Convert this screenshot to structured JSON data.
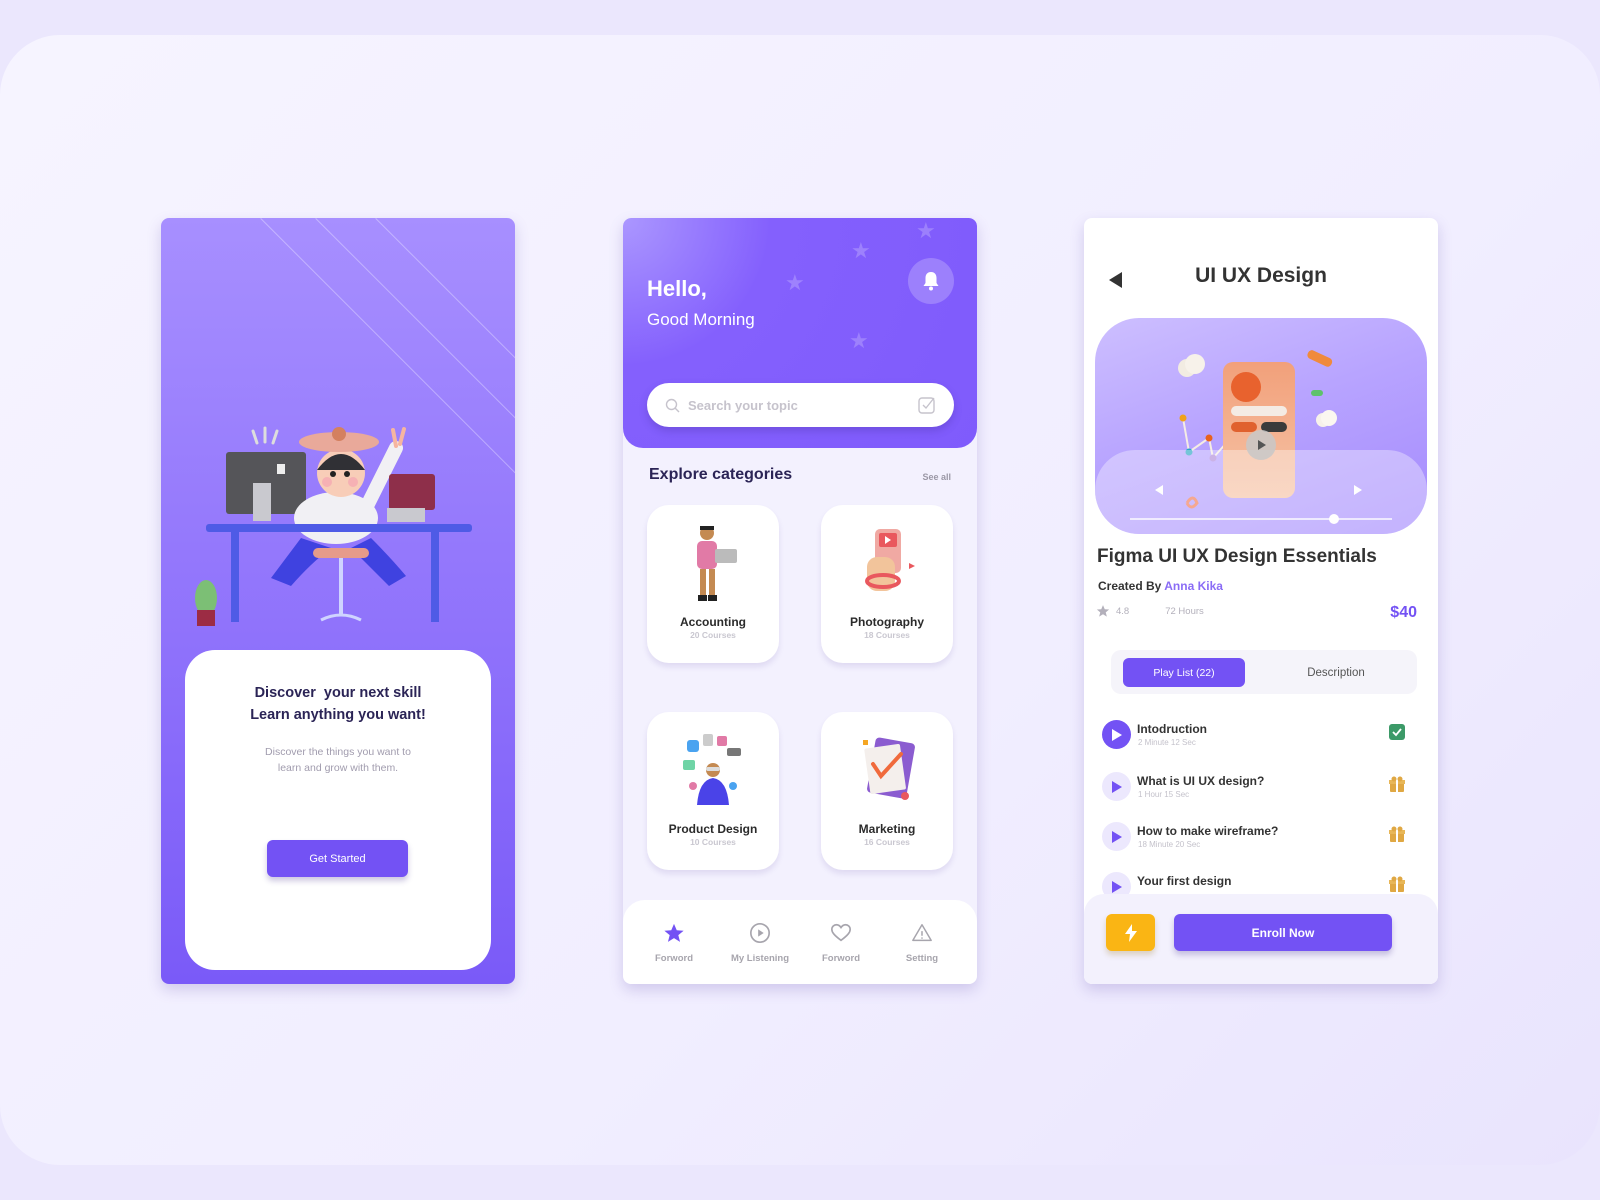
{
  "colors": {
    "accent": "#7352f4",
    "accent_light": "#8a6cf6",
    "warning": "#fab514",
    "success": "#3c9a68",
    "locked": "#e0a843",
    "heading": "#2b2456"
  },
  "onboarding": {
    "headline_line1": "Discover  your next skill",
    "headline_line2": "Learn anything you want!",
    "body_line1": "Discover the things you want to",
    "body_line2": "learn and grow with them.",
    "cta_label": "Get Started",
    "illustration": "person-at-desk-3d-illustration"
  },
  "home": {
    "greeting": "Hello,",
    "subgreeting": "Good Morning",
    "bell_icon": "bell-icon",
    "search": {
      "placeholder": "Search your topic",
      "value": ""
    },
    "section_title": "Explore categories",
    "see_all": "See all",
    "categories": [
      {
        "name": "Accounting",
        "count": "20 Courses",
        "illustration": "man-with-laptop"
      },
      {
        "name": "Photography",
        "count": "18 Courses",
        "illustration": "hand-holding-phone"
      },
      {
        "name": "Product Design",
        "count": "10 Courses",
        "illustration": "vr-user-with-apps"
      },
      {
        "name": "Marketing",
        "count": "16 Courses",
        "illustration": "clipboard-checkmark"
      }
    ],
    "tabs": [
      {
        "label": "Forword",
        "icon": "star-icon",
        "active": true
      },
      {
        "label": "My Listening",
        "icon": "play-circle-icon",
        "active": false
      },
      {
        "label": "Forword",
        "icon": "heart-icon",
        "active": false
      },
      {
        "label": "Setting",
        "icon": "warning-icon",
        "active": false
      }
    ]
  },
  "course": {
    "header_title": "UI UX Design",
    "video_progress": 0.78,
    "title": "Figma UI UX Design Essentials",
    "created_by_label": "Created By",
    "author": "Anna Kika",
    "rating": "4.8",
    "duration": "72 Hours",
    "price": "$40",
    "segments": {
      "playlist": "Play List (22)",
      "description": "Description",
      "active": "playlist"
    },
    "lessons": [
      {
        "title": "Intodruction",
        "duration": "2 Minute 12 Sec",
        "status": "completed"
      },
      {
        "title": "What is UI UX design?",
        "duration": "1 Hour 15 Sec",
        "status": "locked"
      },
      {
        "title": "How to make wireframe?",
        "duration": "18 Minute 20 Sec",
        "status": "locked"
      },
      {
        "title": "Your first design",
        "duration": "",
        "status": "locked"
      }
    ],
    "enroll_label": "Enroll Now"
  }
}
